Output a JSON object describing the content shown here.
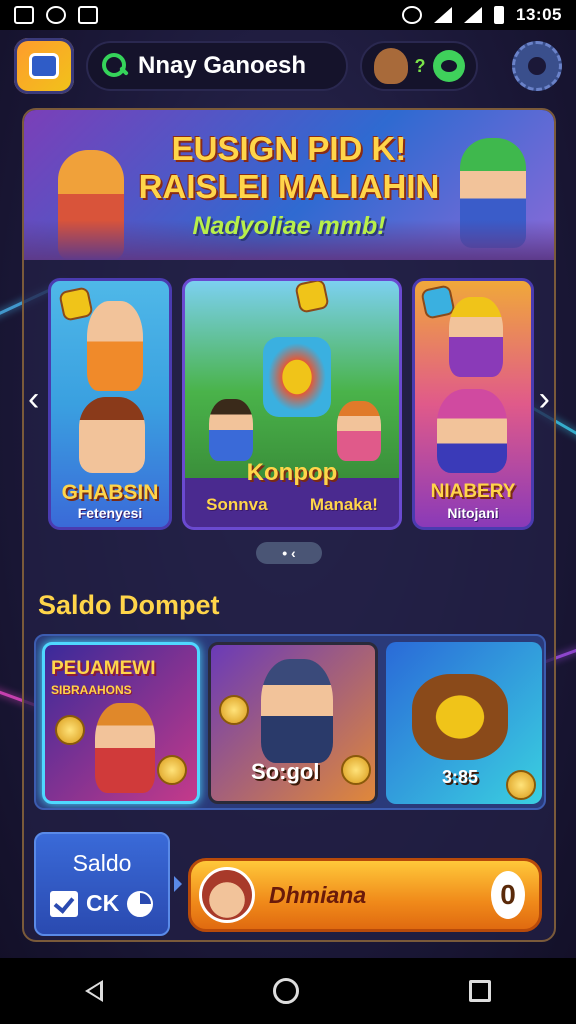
{
  "status_bar": {
    "time": "13:05",
    "icons": [
      "gallery-icon",
      "alarm-icon",
      "mail-icon",
      "wifi-icon",
      "signal-icon",
      "battery-icon"
    ]
  },
  "header": {
    "search_text": "Nnay Ganoesh",
    "currency_symbol": "?",
    "icons": [
      "app-logo",
      "search-icon",
      "character-icon",
      "smile-icon",
      "settings-gear-icon"
    ]
  },
  "banner": {
    "line1": "EUSIGN PID K!",
    "line2": "RAISLEI MALIAHIN",
    "subtitle": "Nadyoliae mmb!"
  },
  "carousel": {
    "cards": [
      {
        "title": "GHABSIN",
        "subtitle": "Fetenyesi"
      },
      {
        "title": "Konpop",
        "footer_left": "Sonnva",
        "footer_right": "Manaka!"
      },
      {
        "title": "NIABERY",
        "subtitle": "Nitojani"
      }
    ],
    "pager_text": "• ‹"
  },
  "wallet": {
    "section_title": "Saldo Dompet",
    "cards": [
      {
        "title": "PEUAMEWI",
        "subtitle": "SIBRAAHONS",
        "value": ""
      },
      {
        "title": "",
        "subtitle": "",
        "value": "So:gol"
      },
      {
        "title": "",
        "subtitle": "",
        "value": "3:85"
      }
    ]
  },
  "balance": {
    "label": "Saldo",
    "value": "CK",
    "cta_label": "Dhmiana",
    "cta_badge": "0"
  },
  "colors": {
    "accent_yellow": "#ffd54a",
    "cta_orange": "#f08a1a",
    "search_green": "#35d35a",
    "bg": "#1b1838"
  }
}
